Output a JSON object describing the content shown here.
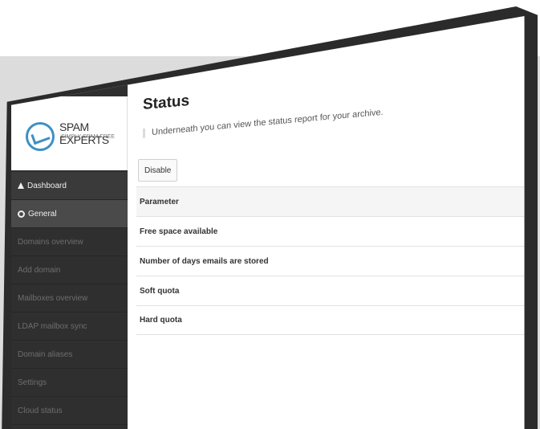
{
  "brand": {
    "title": "SPAM EXPERTS",
    "subtitle": "SIMPLY SPAM FREE"
  },
  "sidebar": {
    "items": [
      {
        "label": "Dashboard",
        "icon": "home-icon"
      },
      {
        "label": "General",
        "icon": "globe-icon"
      },
      {
        "label": "Domains overview"
      },
      {
        "label": "Add domain"
      },
      {
        "label": "Mailboxes overview"
      },
      {
        "label": "LDAP mailbox sync"
      },
      {
        "label": "Domain aliases"
      },
      {
        "label": "Settings"
      },
      {
        "label": "Cloud status"
      }
    ]
  },
  "main": {
    "title": "Status",
    "description": "Underneath you can view the status report for your archive.",
    "disable_label": "Disable",
    "table": {
      "header": "Parameter",
      "rows": [
        "Free space available",
        "Number of days emails are stored",
        "Soft quota",
        "Hard quota"
      ]
    }
  },
  "colors": {
    "accent": "#3f8fc6",
    "sidebar": "#2f2f2f"
  }
}
